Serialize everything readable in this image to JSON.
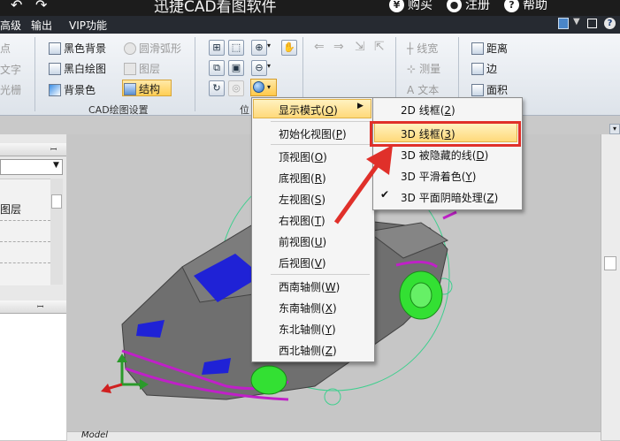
{
  "titlebar": {
    "app_title": "迅捷CAD看图软件",
    "buy_label": "购买",
    "register_label": "注册",
    "help_label": "帮助"
  },
  "menubar": {
    "items": [
      {
        "label": "高级"
      },
      {
        "label": "输出"
      },
      {
        "label": "VIP功能"
      }
    ]
  },
  "ribbon": {
    "left_partial": [
      "点",
      "文字",
      "光栅"
    ],
    "cad_settings": {
      "items": [
        {
          "label": "黑色背景",
          "enabled": true
        },
        {
          "label": "黑白绘图",
          "enabled": true
        },
        {
          "label": "背景色",
          "enabled": true
        },
        {
          "label": "圆滑弧形",
          "enabled": false
        },
        {
          "label": "图层",
          "enabled": false
        },
        {
          "label": "结构",
          "enabled": true,
          "active": true
        }
      ],
      "group_label": "CAD绘图设置"
    },
    "position_group_label": "位",
    "measure": {
      "items": [
        {
          "label": "线宽",
          "enabled": false
        },
        {
          "label": "测量",
          "enabled": false
        },
        {
          "label": "文本",
          "enabled": false
        }
      ]
    },
    "dimension": {
      "items": [
        {
          "label": "距离",
          "enabled": true
        },
        {
          "label": "边",
          "enabled": true
        },
        {
          "label": "面积",
          "enabled": true
        }
      ]
    }
  },
  "view_menu": {
    "items": [
      {
        "label": "显示模式",
        "key": "O",
        "submenu": true
      },
      {
        "label": "初始化视图",
        "key": "P"
      },
      {
        "label": "顶视图",
        "key": "O"
      },
      {
        "label": "底视图",
        "key": "R"
      },
      {
        "label": "左视图",
        "key": "S"
      },
      {
        "label": "右视图",
        "key": "T"
      },
      {
        "label": "前视图",
        "key": "U"
      },
      {
        "label": "后视图",
        "key": "V"
      },
      {
        "label": "西南轴侧",
        "key": "W"
      },
      {
        "label": "东南轴侧",
        "key": "X"
      },
      {
        "label": "东北轴侧",
        "key": "Y"
      },
      {
        "label": "西北轴侧",
        "key": "Z"
      }
    ]
  },
  "display_mode_submenu": {
    "items": [
      {
        "label": "2D 线框",
        "key": "2",
        "checked": false
      },
      {
        "label": "3D 线框",
        "key": "3",
        "checked": false,
        "highlighted": true
      },
      {
        "label": "3D 被隐藏的线",
        "key": "D",
        "checked": false
      },
      {
        "label": "3D 平滑着色",
        "key": "Y",
        "checked": false
      },
      {
        "label": "3D 平面阴暗处理",
        "key": "Z",
        "checked": true
      }
    ]
  },
  "left_panel": {
    "layer_item": "图层"
  },
  "model_tab": "Model",
  "colors": {
    "highlight_box": "#e0302a",
    "arrow": "#e0302a",
    "menu_highlight": "#ffd97a"
  }
}
